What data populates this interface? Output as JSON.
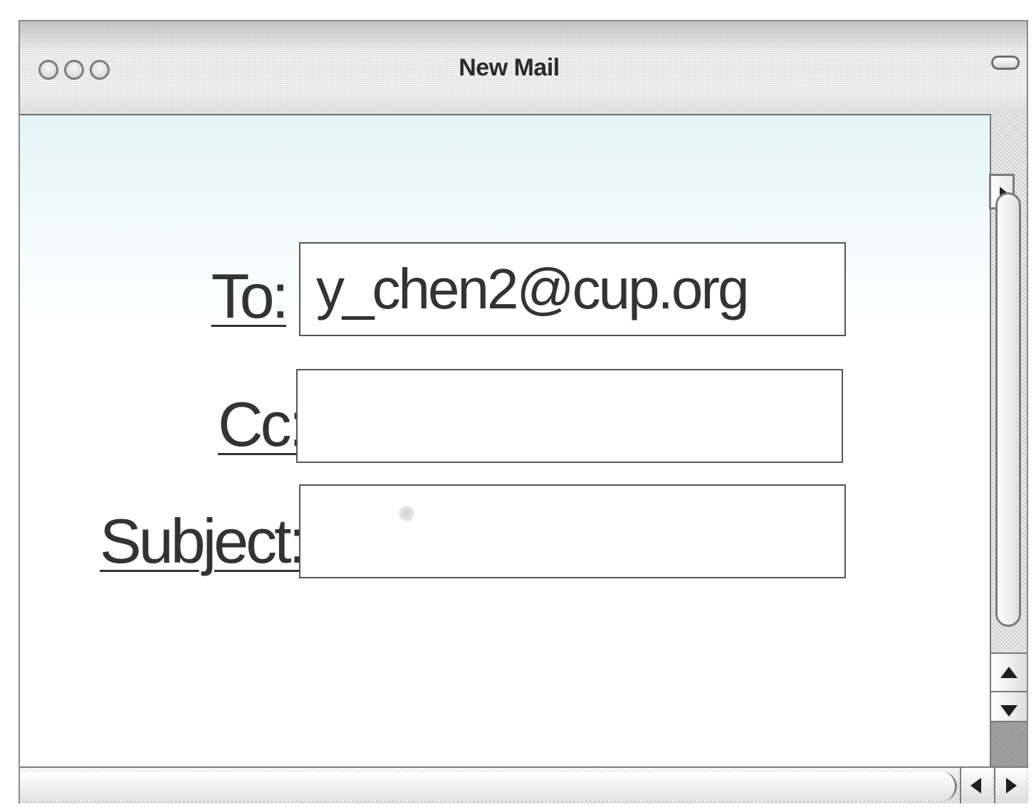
{
  "window": {
    "title": "New Mail"
  },
  "fields": {
    "to": {
      "label": "To:",
      "value": "y_chen2@cup.org"
    },
    "cc": {
      "label": "Cc:",
      "value": ""
    },
    "subject": {
      "label": "Subject:",
      "value": ""
    }
  },
  "icons": {
    "traffic_lights": [
      "close-button-icon",
      "minimize-button-icon",
      "zoom-button-icon"
    ],
    "toolbar_toggle": "toolbar-toggle-icon",
    "scroll_up": "triangle-up-icon",
    "scroll_down": "triangle-down-icon",
    "scroll_left": "triangle-left-icon",
    "scroll_right": "triangle-right-icon"
  },
  "colors": {
    "content_tint": "#e3f4f6",
    "chrome_border": "#7a7a7a",
    "text": "#333333"
  }
}
